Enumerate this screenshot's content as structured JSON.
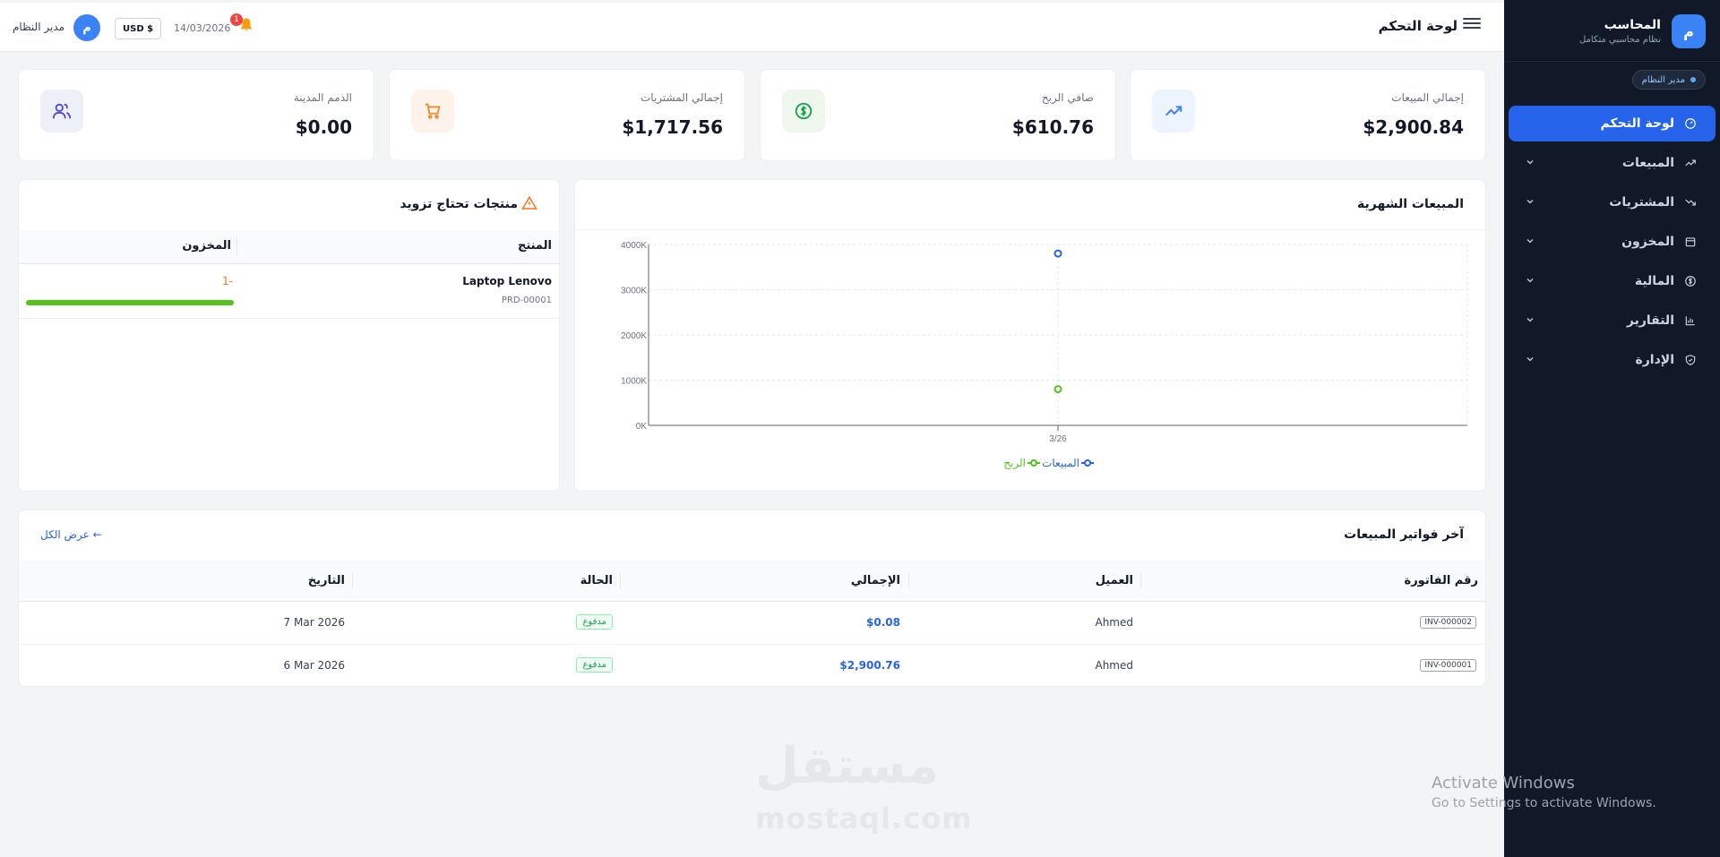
{
  "sidebar": {
    "logo_letter": "م",
    "app_name": "المحاسب",
    "app_subtitle": "نظام محاسبي متكامل",
    "role_badge": "مدير النظام",
    "items": [
      {
        "label": "لوحة التحكم",
        "icon": "dashboard-icon",
        "active": true
      },
      {
        "label": "المبيعات",
        "icon": "trend-up-icon"
      },
      {
        "label": "المشتريات",
        "icon": "trend-down-icon"
      },
      {
        "label": "المخزون",
        "icon": "box-icon"
      },
      {
        "label": "المالية",
        "icon": "dollar-icon"
      },
      {
        "label": "التقارير",
        "icon": "bar-chart-icon"
      },
      {
        "label": "الإدارة",
        "icon": "shield-icon"
      }
    ]
  },
  "header": {
    "title": "لوحة التحكم",
    "user_avatar": "م",
    "user_name": "مدير النظام",
    "currency": "USD $",
    "date": "14/03/2026",
    "notification_count": "1"
  },
  "stats": [
    {
      "label": "إجمالي المبيعات",
      "value": "$2,900.84",
      "icon": "trend-up-icon",
      "color": "#3b82f6",
      "bg": "#eef4fd"
    },
    {
      "label": "صافي الربح",
      "value": "$610.76",
      "icon": "dollar-circle-icon",
      "color": "#16a34a",
      "bg": "#eef6ee"
    },
    {
      "label": "إجمالي المشتريات",
      "value": "$1,717.56",
      "icon": "cart-icon",
      "color": "#ea8a2e",
      "bg": "#fdf3ea"
    },
    {
      "label": "الذمم المدينة",
      "value": "$0.00",
      "icon": "users-icon",
      "color": "#6366f1",
      "bg": "#eef0f7"
    }
  ],
  "monthly_sales": {
    "title": "المبيعات الشهرية"
  },
  "chart_data": {
    "type": "line",
    "title": "المبيعات الشهرية",
    "categories": [
      "3/26"
    ],
    "series": [
      {
        "name": "المبيعات",
        "values": [
          3800
        ],
        "color": "#2563eb"
      },
      {
        "name": "الربح",
        "values": [
          800
        ],
        "color": "#52c41a"
      }
    ],
    "yticks": [
      "0K",
      "1000K",
      "2000K",
      "3000K",
      "4000K"
    ],
    "ylim": [
      0,
      4000
    ],
    "grid": true,
    "legend": "bottom"
  },
  "low_stock": {
    "title": "منتجات تحتاج تزويد",
    "col_product": "المنتج",
    "col_stock": "المخزون",
    "rows": [
      {
        "name": "Laptop Lenovo",
        "sku": "PRD-00001",
        "stock": "1-",
        "level": 1.0
      }
    ]
  },
  "invoices": {
    "title": "آخر فواتير المبيعات",
    "view_all": "عرض الكل ←",
    "columns": [
      "رقم الفاتورة",
      "العميل",
      "الإجمالي",
      "الحالة",
      "التاريخ"
    ],
    "rows": [
      {
        "number": "INV-000002",
        "customer": "Ahmed",
        "total": "$0.08",
        "status": "مدفوع",
        "date": "7 Mar 2026"
      },
      {
        "number": "INV-000001",
        "customer": "Ahmed",
        "total": "$2,900.76",
        "status": "مدفوع",
        "date": "6 Mar 2026"
      }
    ]
  },
  "watermark": {
    "arabic": "مستقل",
    "latin": "mostaql.com"
  },
  "windows_activation": {
    "title": "Activate Windows",
    "subtitle": "Go to Settings to activate Windows."
  }
}
